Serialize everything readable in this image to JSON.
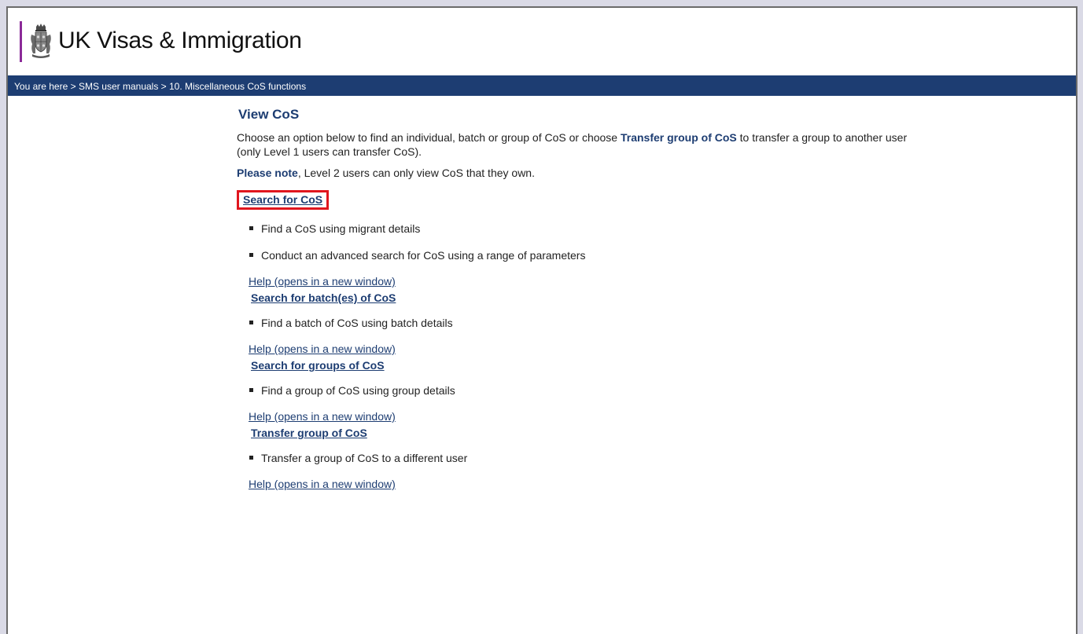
{
  "header": {
    "title": "UK Visas & Immigration",
    "brand_color": "#8b2a98"
  },
  "breadcrumb": {
    "text": "You are here > SMS user manuals > 10. Miscellaneous CoS functions"
  },
  "page": {
    "title": "View CoS",
    "intro_before": "Choose an option below to find an individual, batch or group of CoS or choose ",
    "intro_bold": "Transfer group of CoS",
    "intro_after": " to transfer a group to another user (only Level 1 users can transfer CoS).",
    "note_bold": "Please note",
    "note_rest": ", Level 2 users can only view CoS that they own."
  },
  "sections": [
    {
      "link": "Search for CoS",
      "bullets": [
        "Find a CoS using migrant details",
        "Conduct an advanced search for CoS using a range of parameters"
      ],
      "help": "Help (opens in a new window)"
    },
    {
      "link": "Search for batch(es) of CoS",
      "bullets": [
        "Find a batch of CoS using batch details"
      ],
      "help": "Help (opens in a new window)"
    },
    {
      "link": "Search for groups of CoS",
      "bullets": [
        "Find a group of CoS using group details"
      ],
      "help": "Help (opens in a new window)"
    },
    {
      "link": "Transfer group of CoS",
      "bullets": [
        "Transfer a group of CoS to a different user"
      ],
      "help": "Help (opens in a new window)"
    }
  ],
  "colors": {
    "breadcrumb_bg": "#1d3d72",
    "link": "#1d3d72",
    "highlight_border": "#e0161e"
  },
  "icons": {
    "crest": "royal-crest-icon"
  }
}
